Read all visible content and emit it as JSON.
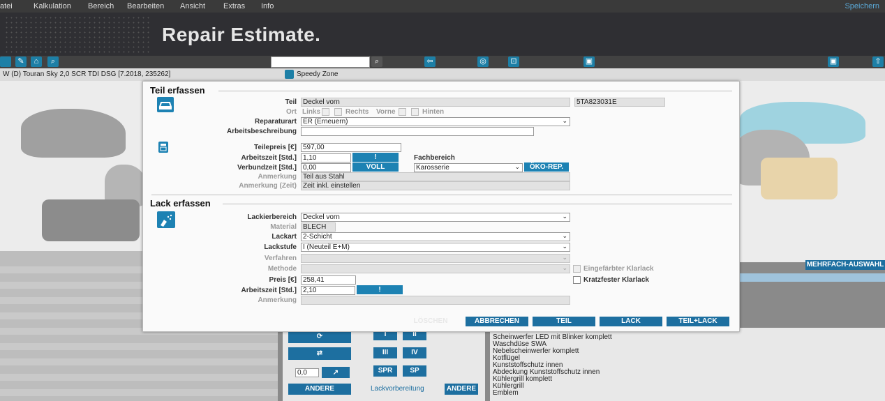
{
  "menu": {
    "items": [
      "atei",
      "Kalkulation",
      "Bereich",
      "Bearbeiten",
      "Ansicht",
      "Extras",
      "Info"
    ],
    "save": "Speichern"
  },
  "header": {
    "title": "Repair Estimate."
  },
  "vehicle": {
    "description": "W (D) Touran Sky 2,0 SCR TDI DSG [7.2018, 235262]",
    "speedy_zone": "Speedy Zone"
  },
  "dialog": {
    "teil": {
      "heading": "Teil erfassen",
      "teil_label": "Teil",
      "teil_value": "Deckel vorn",
      "part_number": "5TA823031E",
      "ort_label": "Ort",
      "ort_links": "Links",
      "ort_rechts": "Rechts",
      "ort_vorne": "Vorne",
      "ort_hinten": "Hinten",
      "reparaturart_label": "Reparaturart",
      "reparaturart_value": "ER (Erneuern)",
      "arbeitsbeschreibung_label": "Arbeitsbeschreibung",
      "arbeitsbeschreibung_value": "",
      "teilepreis_label": "Teilepreis [€]",
      "teilepreis_value": "597,00",
      "arbeitszeit_label": "Arbeitszeit [Std.]",
      "arbeitszeit_value": "1,10",
      "excl_button": "!",
      "fachbereich_label": "Fachbereich",
      "fachbereich_value": "Karosserie",
      "verbundzeit_label": "Verbundzeit [Std.]",
      "verbundzeit_value": "0,00",
      "voll_button": "VOLL",
      "oeko_button": "ÖKO-REP.",
      "anmerkung_label": "Anmerkung",
      "anmerkung_value": "Teil aus Stahl",
      "anmerkung_zeit_label": "Anmerkung (Zeit)",
      "anmerkung_zeit_value": "Zeit inkl. einstellen"
    },
    "lack": {
      "heading": "Lack erfassen",
      "lackierbereich_label": "Lackierbereich",
      "lackierbereich_value": "Deckel vorn",
      "material_label": "Material",
      "material_value": "BLECH",
      "lackart_label": "Lackart",
      "lackart_value": "2-Schicht",
      "lackstufe_label": "Lackstufe",
      "lackstufe_value": "I (Neuteil E+M)",
      "verfahren_label": "Verfahren",
      "methode_label": "Methode",
      "eingefaerbt_label": "Eingefärbter Klarlack",
      "preis_label": "Preis [€]",
      "preis_value": "258,41",
      "kratzfest_label": "Kratzfester Klarlack",
      "arbeitszeit_label": "Arbeitszeit [Std.]",
      "arbeitszeit_value": "2,10",
      "excl_button": "!",
      "anmerkung_label": "Anmerkung"
    },
    "footer": {
      "loeschen": "LÖSCHEN",
      "abbrechen": "ABBRECHEN",
      "teil": "TEIL",
      "lack": "LACK",
      "teil_lack": "TEIL+LACK"
    }
  },
  "side": {
    "mehrfach": "MEHRFACH-AUSWAHL"
  },
  "lower_mid": {
    "roman": [
      "I",
      "II",
      "III",
      "IV"
    ],
    "spr": "SPR",
    "sp": "SP",
    "stepper_value": "0,0",
    "andere1": "ANDERE",
    "lackvorbereitung": "Lackvorbereitung",
    "andere2": "ANDERE"
  },
  "parts": [
    "Scheinwerfer LED mit Blinker komplett",
    "Waschdüse SWA",
    "Nebelscheinwerfer komplett",
    "Kotflügel",
    "Kunststoffschutz innen",
    "Abdeckung Kunststoffschutz innen",
    "Kühlergrill komplett",
    "Kühlergrill",
    "Emblem"
  ]
}
